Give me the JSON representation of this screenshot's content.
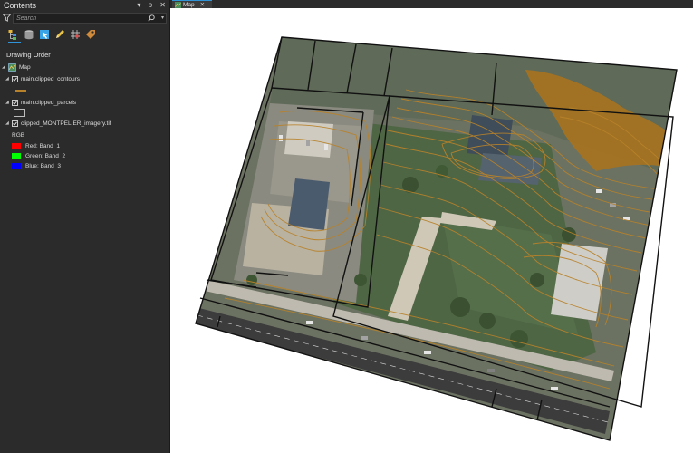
{
  "contents": {
    "title": "Contents",
    "controls": {
      "menu": "▾",
      "pin": "ᵽ",
      "close": "✕"
    },
    "search_placeholder": "Search",
    "toolbar_icons": [
      "list-by-drawing-order-icon",
      "list-by-data-source-icon",
      "list-by-selection-icon",
      "list-by-editing-icon",
      "list-by-snapping-icon",
      "list-by-labeling-icon"
    ],
    "section_title": "Drawing Order",
    "map_label": "Map",
    "layers": [
      {
        "name": "main.clipped_contours",
        "checked": true,
        "symbol_color": "#b8822a"
      },
      {
        "name": "main.clipped_parcels",
        "checked": true,
        "symbol_color": "#2b2b2b"
      },
      {
        "name": "clipped_MONTPELIER_imagery.tif",
        "checked": true
      }
    ],
    "rgb_label": "RGB",
    "bands": [
      {
        "label": "Red:  Band_1",
        "color": "#ff0000"
      },
      {
        "label": "Green: Band_2",
        "color": "#00ff00"
      },
      {
        "label": "Blue:  Band_3",
        "color": "#0000ff"
      }
    ]
  },
  "map_tab": {
    "label": "Map",
    "close": "✕"
  },
  "colors": {
    "accent": "#2f95d8",
    "contour": "#b8822a",
    "parcel": "#111111"
  }
}
